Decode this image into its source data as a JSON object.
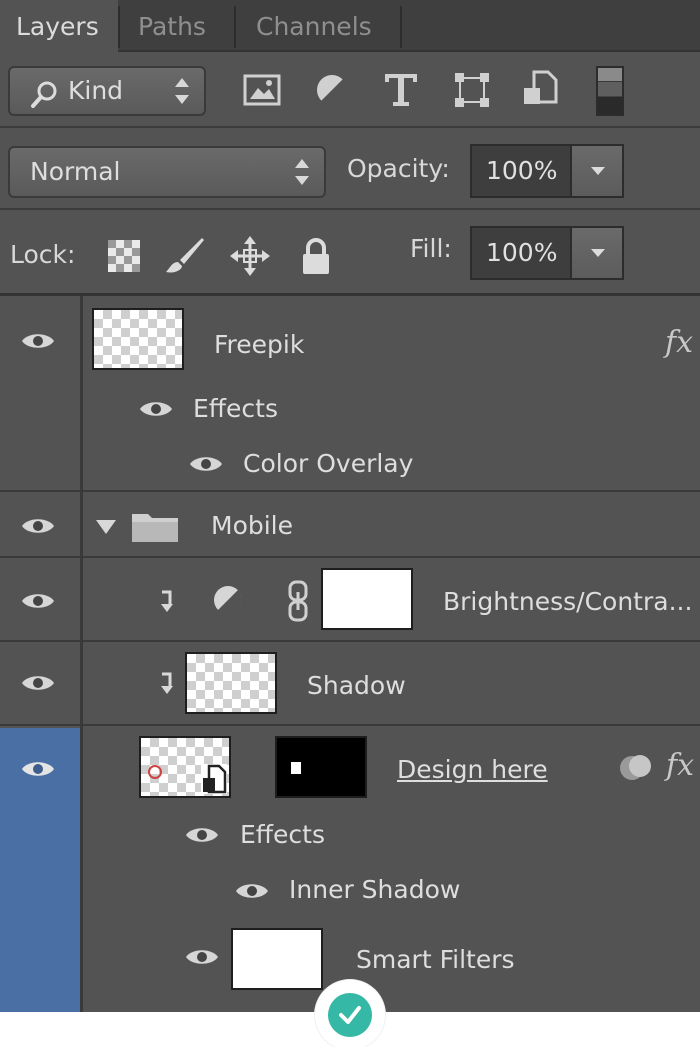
{
  "tabs": [
    "Layers",
    "Paths",
    "Channels"
  ],
  "filter": {
    "label": "Kind"
  },
  "blend": {
    "mode": "Normal",
    "opacity_label": "Opacity:",
    "opacity_value": "100%"
  },
  "lock": {
    "label": "Lock:",
    "fill_label": "Fill:",
    "fill_value": "100%"
  },
  "layers": [
    {
      "name": "Freepik",
      "fx": "fx",
      "effects_label": "Effects",
      "effect": "Color Overlay"
    },
    {
      "name": "Mobile"
    },
    {
      "name": "Brightness/Contra..."
    },
    {
      "name": "Shadow"
    },
    {
      "name": "Design here",
      "fx": "fx",
      "effects_label": "Effects",
      "effect": "Inner Shadow",
      "smart_filters": "Smart Filters"
    }
  ],
  "colors": {
    "panel": "#535353",
    "selected": "#4a6fa5",
    "badge": "#35b8a5"
  }
}
